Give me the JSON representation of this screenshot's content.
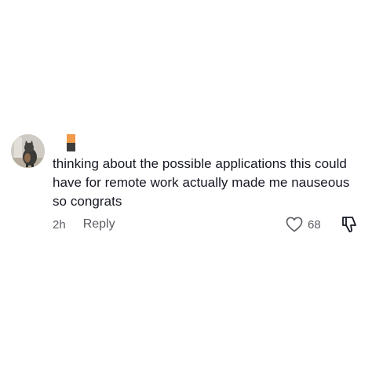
{
  "comment": {
    "avatar_icon": "cat-avatar",
    "username_colors": [
      "#f09a4a",
      "#3c3c3c"
    ],
    "text": "thinking about the possible applications this could have for remote work actually made me nauseous so congrats",
    "timestamp": "2h",
    "reply_label": "Reply",
    "like_icon": "heart-outline-icon",
    "like_count": "68",
    "dislike_icon": "thumbs-down-icon",
    "text_color": "#161823",
    "meta_color": "#5b5d63"
  }
}
